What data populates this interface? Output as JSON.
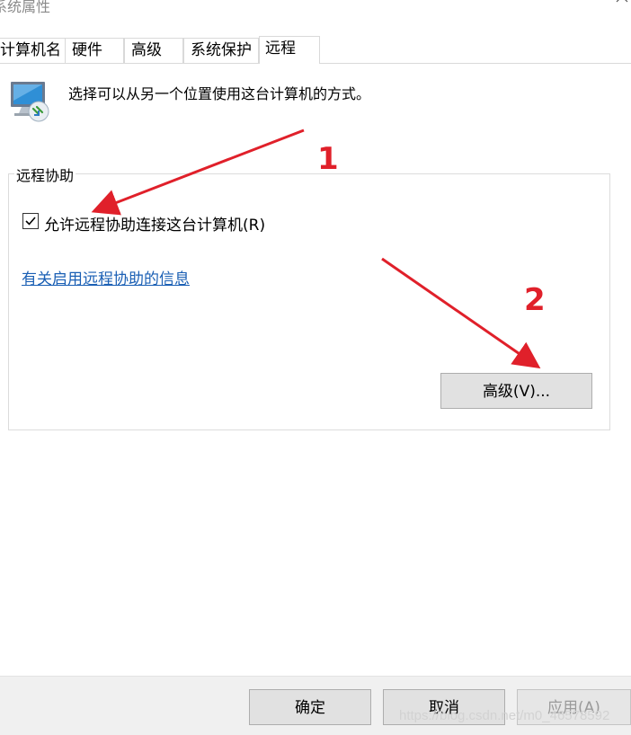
{
  "window": {
    "title": "系统属性"
  },
  "tabs": [
    {
      "label": "计算机名",
      "active": false
    },
    {
      "label": "硬件",
      "active": false
    },
    {
      "label": "高级",
      "active": false
    },
    {
      "label": "系统保护",
      "active": false
    },
    {
      "label": "远程",
      "active": true
    }
  ],
  "intro_text": "选择可以从另一个位置使用这台计算机的方式。",
  "remote_assistance": {
    "group_title": "远程协助",
    "checkbox_label": "允许远程协助连接这台计算机(R)",
    "checked": true,
    "help_link": "有关启用远程协助的信息",
    "advanced_button": "高级(V)..."
  },
  "footer": {
    "ok": "确定",
    "cancel": "取消",
    "apply": "应用(A)"
  },
  "annotations": {
    "marker_1": "1",
    "marker_2": "2",
    "color": "#e0202a"
  },
  "watermark": "https://blog.csdn.net/m0_46578592",
  "icons": {
    "app": "remote-desktop-icon",
    "close": "close-icon",
    "check": "checkmark-icon"
  }
}
